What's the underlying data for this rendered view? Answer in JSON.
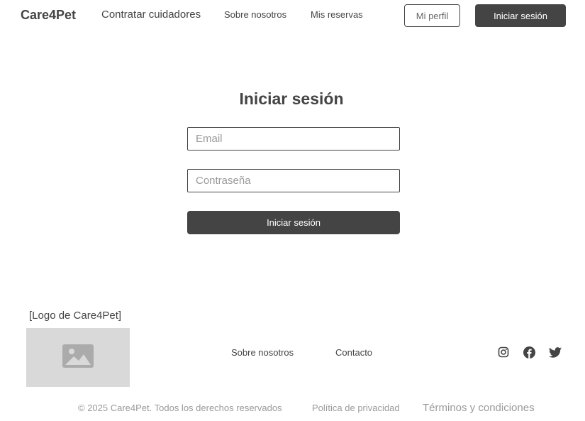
{
  "header": {
    "brand": "Care4Pet",
    "nav": {
      "contratar": "Contratar cuidadores",
      "sobre": "Sobre nosotros",
      "reservas": "Mis reservas"
    },
    "profile_button": "Mi perfil",
    "login_button": "Iniciar sesión"
  },
  "login": {
    "title": "Iniciar sesión",
    "email_placeholder": "Email",
    "email_value": "",
    "password_placeholder": "Contraseña",
    "password_value": "",
    "submit_label": "Iniciar sesión"
  },
  "footer": {
    "logo_caption": "[Logo de Care4Pet]",
    "logo_icon": "image-placeholder-icon",
    "links": {
      "sobre": "Sobre nosotros",
      "contacto": "Contacto"
    },
    "social_icons": [
      "instagram-icon",
      "facebook-icon",
      "twitter-icon"
    ],
    "copyright": "© 2025 Care4Pet. Todos los derechos reservados",
    "privacy": "Política de privacidad",
    "terms": "Términos y condiciones"
  },
  "colors": {
    "primary": "#444444",
    "muted_text": "#9a9a9a",
    "placeholder_bg": "#d9d9d9",
    "background": "#ffffff"
  }
}
